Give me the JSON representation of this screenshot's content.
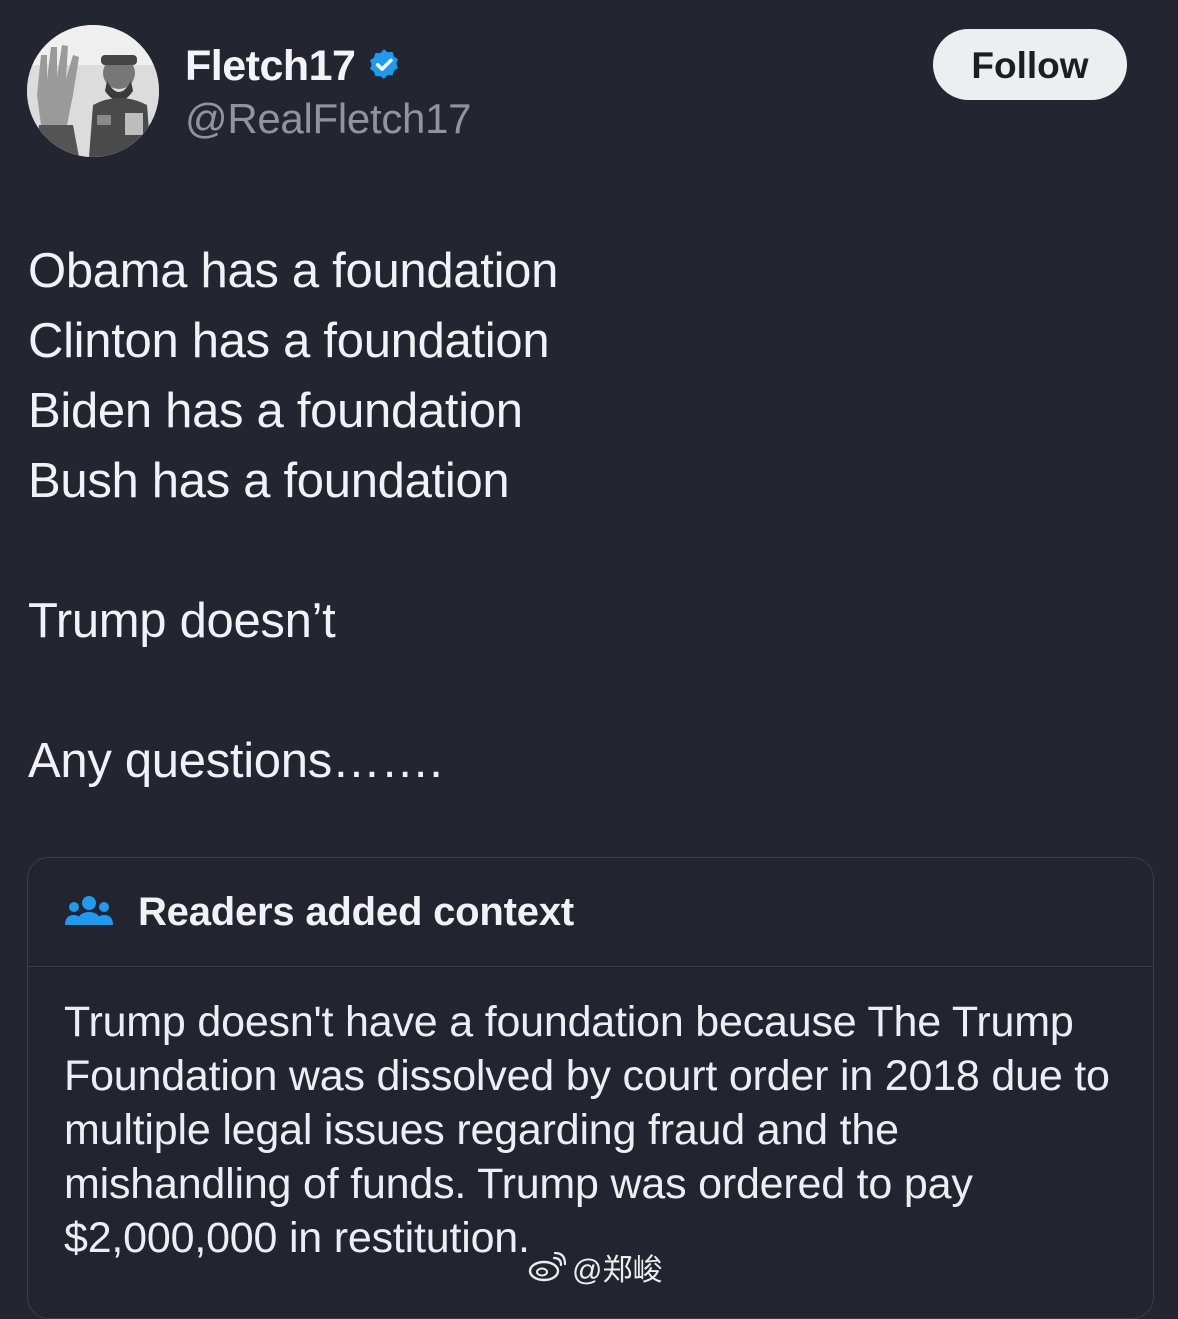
{
  "author": {
    "display_name": "Fletch17",
    "handle": "@RealFletch17",
    "verified": true,
    "verified_icon": "verified-badge-icon",
    "verified_color": "#1d9bf0"
  },
  "follow_button": {
    "label": "Follow"
  },
  "post": {
    "lines": [
      "Obama has a foundation",
      "Clinton has a foundation",
      "Biden has a foundation",
      "Bush has a foundation",
      "",
      "Trump doesn’t",
      "",
      "Any questions……."
    ]
  },
  "community_note": {
    "icon": "people-icon",
    "icon_color": "#1d9bf0",
    "title": "Readers added context",
    "body": "Trump doesn't have a foundation because The Trump Foundation was dissolved by court order in 2018 due to multiple legal issues regarding fraud and the mishandling of funds. Trump was ordered to pay $2,000,000 in restitution."
  },
  "watermark": {
    "icon": "weibo-icon",
    "text": "@郑峻"
  }
}
